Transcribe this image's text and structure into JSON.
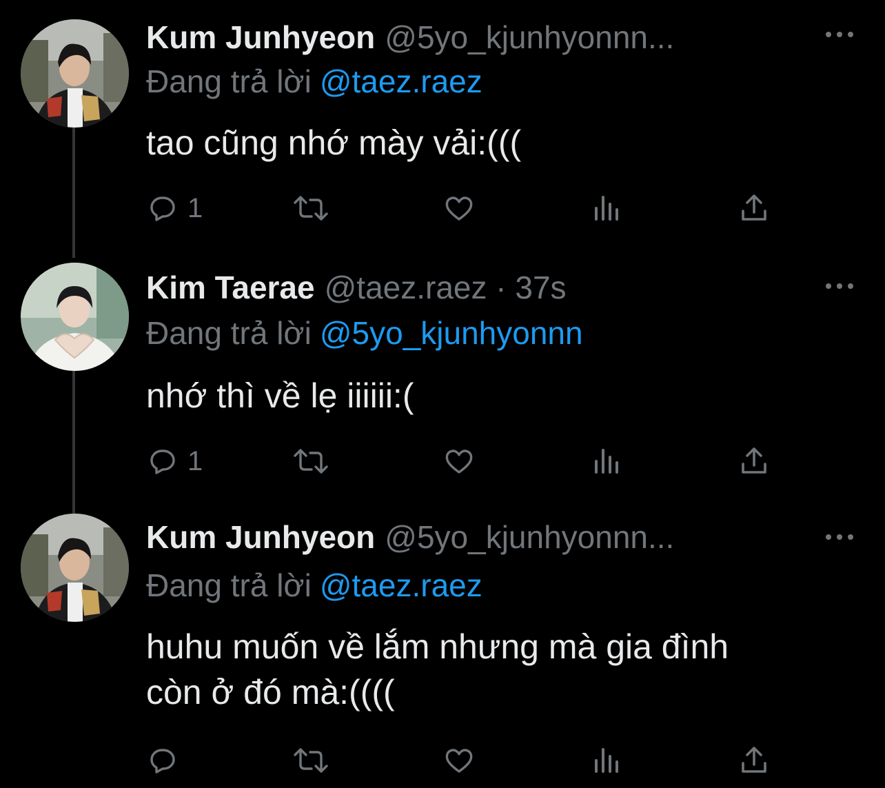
{
  "thread": [
    {
      "author_name": "Kum Junhyeon",
      "handle": "@5yo_kjunhyonnn...",
      "reply_prefix": "Đang trả lời",
      "reply_mention": "@taez.raez",
      "text_lines": [
        "tao cũng nhớ mày vải:((("
      ],
      "reply_count": "1",
      "avatar": "avatar-junhyeon"
    },
    {
      "author_name": "Kim Taerae",
      "handle": "@taez.raez · 37s",
      "reply_prefix": "Đang trả lời",
      "reply_mention": "@5yo_kjunhyonnn",
      "text_lines": [
        "nhớ thì về lẹ iiiiii:("
      ],
      "reply_count": "1",
      "avatar": "avatar-taerae"
    },
    {
      "author_name": "Kum Junhyeon",
      "handle": "@5yo_kjunhyonnn...",
      "reply_prefix": "Đang trả lời",
      "reply_mention": "@taez.raez",
      "text_lines": [
        "huhu muốn về lắm nhưng mà gia đình",
        "còn ở đó mà:(((("
      ],
      "reply_count": "",
      "avatar": "avatar-junhyeon"
    }
  ],
  "icons": {
    "reply": "reply-icon",
    "retweet": "retweet-icon",
    "like": "heart-icon",
    "views": "views-icon",
    "share": "share-icon",
    "more": "more-icon"
  },
  "colors": {
    "background": "#000000",
    "primary_text": "#e7e9ea",
    "secondary_text": "#71767b",
    "link": "#1d9bf0",
    "thread_line": "#333639"
  }
}
